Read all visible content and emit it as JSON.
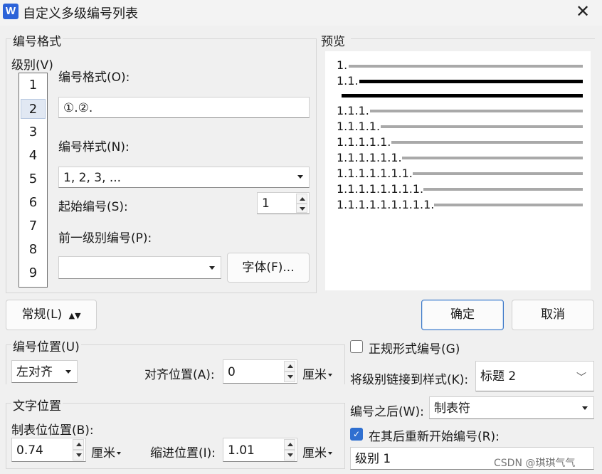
{
  "window": {
    "title": "自定义多级编号列表",
    "app_icon_letter": "W"
  },
  "number_format": {
    "group_label": "编号格式",
    "level_label": "级别(V)",
    "levels": [
      "1",
      "2",
      "3",
      "4",
      "5",
      "6",
      "7",
      "8",
      "9"
    ],
    "selected_level": "2",
    "format_label": "编号格式(O):",
    "format_value": "①.②.",
    "style_label": "编号样式(N):",
    "style_value": "1, 2, 3, ...",
    "start_label": "起始编号(S):",
    "start_value": "1",
    "prev_level_label": "前一级别编号(P):",
    "prev_level_value": "",
    "font_button": "字体(F)..."
  },
  "preview": {
    "group_label": "预览",
    "rows": [
      {
        "text": "1.",
        "bold": false
      },
      {
        "text": "1.1.",
        "bold": true
      },
      {
        "text": "",
        "bold": true
      },
      {
        "text": "1.1.1.",
        "bold": false
      },
      {
        "text": "1.1.1.1.",
        "bold": false
      },
      {
        "text": "1.1.1.1.1.",
        "bold": false
      },
      {
        "text": "1.1.1.1.1.1.",
        "bold": false
      },
      {
        "text": "1.1.1.1.1.1.1.",
        "bold": false
      },
      {
        "text": "1.1.1.1.1.1.1.1.",
        "bold": false
      },
      {
        "text": "1.1.1.1.1.1.1.1.1.",
        "bold": false
      }
    ]
  },
  "buttons": {
    "general": "常规(L)",
    "ok": "确定",
    "cancel": "取消"
  },
  "number_position": {
    "group_label": "编号位置(U)",
    "align_value": "左对齐",
    "align_at_label": "对齐位置(A):",
    "align_at_value": "0",
    "unit": "厘米"
  },
  "text_position": {
    "group_label": "文字位置",
    "tab_label": "制表位位置(B):",
    "tab_value": "0.74",
    "tab_unit": "厘米",
    "indent_label": "缩进位置(I):",
    "indent_value": "1.01",
    "indent_unit": "厘米"
  },
  "options": {
    "legal_style_label": "正规形式编号(G)",
    "legal_style_checked": false,
    "link_style_label": "将级别链接到样式(K):",
    "link_style_value": "标题 2",
    "follow_label": "编号之后(W):",
    "follow_value": "制表符",
    "restart_label": "在其后重新开始编号(R):",
    "restart_checked": true,
    "restart_value": "级别 1"
  },
  "watermark": "CSDN @琪琪气气"
}
